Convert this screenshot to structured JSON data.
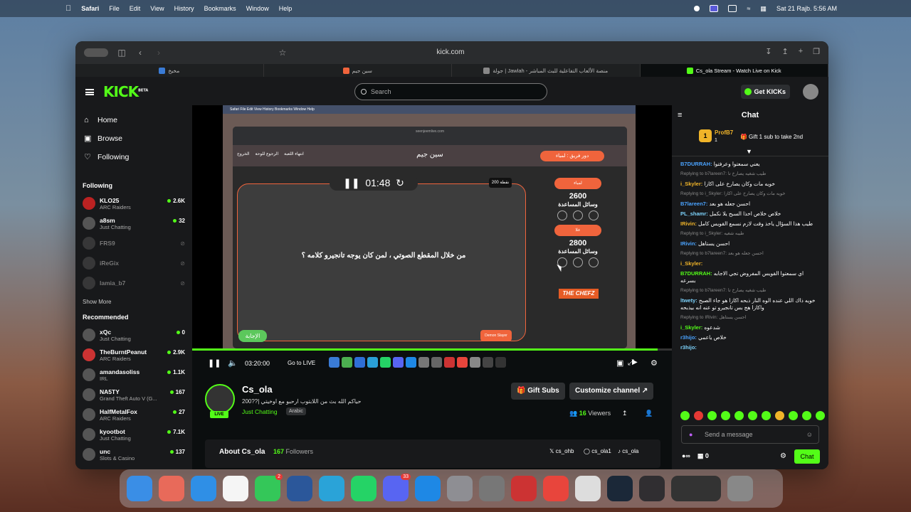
{
  "menubar": {
    "app": "Safari",
    "items": [
      "File",
      "Edit",
      "View",
      "History",
      "Bookmarks",
      "Window",
      "Help"
    ],
    "clock": "Sat 21 Rajb. 5:56 AM"
  },
  "browser": {
    "url": "kick.com",
    "tabs": [
      {
        "label": "مخيخ"
      },
      {
        "label": "سين جيم"
      },
      {
        "label": "جولة | Jawlah - منصة الألعاب التفاعلية للبث المباشر"
      },
      {
        "label": "Cs_ola Stream - Watch Live on Kick"
      }
    ]
  },
  "header": {
    "logo": "KICK",
    "logo_sup": "BETA",
    "search_placeholder": "Search",
    "get_kicks": "Get KICKs"
  },
  "sidebar": {
    "nav": [
      {
        "label": "Home",
        "icon": "home-icon"
      },
      {
        "label": "Browse",
        "icon": "browse-icon"
      },
      {
        "label": "Following",
        "icon": "heart-icon"
      }
    ],
    "following_title": "Following",
    "following": [
      {
        "name": "KLO25",
        "cat": "ARC Raiders",
        "viewers": "2.6K",
        "online": true
      },
      {
        "name": "a8sm",
        "cat": "Just Chatting",
        "viewers": "32",
        "online": true
      },
      {
        "name": "FRS9",
        "cat": "",
        "viewers": "",
        "online": false
      },
      {
        "name": "iReGix",
        "cat": "",
        "viewers": "",
        "online": false
      },
      {
        "name": "lamia_b7",
        "cat": "",
        "viewers": "",
        "online": false
      }
    ],
    "show_more": "Show More",
    "recommended_title": "Recommended",
    "recommended": [
      {
        "name": "xQc",
        "cat": "Just Chatting",
        "viewers": "0"
      },
      {
        "name": "TheBurntPeanut",
        "cat": "ARC Raiders",
        "viewers": "2.9K"
      },
      {
        "name": "amandasoliss",
        "cat": "IRL",
        "viewers": "1.1K"
      },
      {
        "name": "NA5TY",
        "cat": "Grand Theft Auto V (G...",
        "viewers": "167"
      },
      {
        "name": "HalfMetalFox",
        "cat": "ARC Raiders",
        "viewers": "27"
      },
      {
        "name": "kyootbot",
        "cat": "Just Chatting",
        "viewers": "7.1K"
      },
      {
        "name": "unc",
        "cat": "Slots & Casino",
        "viewers": "137"
      }
    ]
  },
  "stream_game": {
    "inner_url": "seenjeemlive.com",
    "title": "سين جيم",
    "team_turn": "دور فريق : لمياء",
    "timer": "01:48",
    "points": "200 نقطة",
    "question": "من خلال المقطع الصوتي ، لمن كان يوجه تانجيرو كلامه ؟",
    "answer_button": "الإجابة",
    "team_tag": "Demon Slayer",
    "team1": {
      "name": "لمياء",
      "score": "2600",
      "aids": "وسائل المساعدة"
    },
    "team2": {
      "name": "علا",
      "score": "2800",
      "aids": "وسائل المساعدة"
    },
    "sponsor": "THE CHEFZ",
    "left_buttons": [
      "الخروج",
      "الرجوع للوحة",
      "انتهاء اللعبة"
    ]
  },
  "player": {
    "time": "03:20:00",
    "go_live": "Go to LIVE",
    "progress": 0.97
  },
  "stream_info": {
    "name": "Cs_ola",
    "live": "LIVE",
    "title": "حياكم الله بث من اللابتوب ارحبو مع اوخيتي |??200",
    "category": "Just Chatting",
    "language": "Arabic",
    "gift_subs": "Gift Subs",
    "customize": "Customize channel",
    "viewers_count": "16",
    "viewers_label": "Viewers",
    "about_title": "About Cs_ola",
    "followers_count": "167",
    "followers_label": "Followers",
    "socials": [
      "cs_ohb",
      "cs_ola1",
      "cs_ola"
    ]
  },
  "chat": {
    "title": "Chat",
    "pinned_user": "ProfB7",
    "pinned_badge": "1",
    "pinned_count": "1",
    "pinned_text": "Gift 1 sub to take 2nd",
    "messages": [
      {
        "type": "msg",
        "user": "B7DURRAH:",
        "text": "يعني سمعتوا وعرفتوا"
      },
      {
        "type": "reply",
        "text": "Replying to b7lareen7: طيب شغيه يصارخ تا"
      },
      {
        "type": "msg",
        "user": "i_Skyler:",
        "text": "خويه مات وكان يصارخ على اكازا"
      },
      {
        "type": "reply",
        "text": "Replying to i_Skyler: خويه مات وكان يصارخ على اكازا"
      },
      {
        "type": "msg",
        "user": "B7lareen7:",
        "text": "احسن جعله هو بعد"
      },
      {
        "type": "msg",
        "user": "PL_shamr:",
        "text": "خلاص خلاص اخذا السبح يلا نكمل"
      },
      {
        "type": "msg",
        "user": "IRivin:",
        "text": "طيب هذا السؤال ياخذ وقت لازم نسمع القويس كامل"
      },
      {
        "type": "reply",
        "text": "Replying to i_Skyler: طيبه شغيه"
      },
      {
        "type": "msg",
        "user": "IRivin:",
        "text": "احسن يستاهل"
      },
      {
        "type": "reply",
        "text": "Replying to b7lareen7: احسن جعله هو بعد"
      },
      {
        "type": "msg",
        "user": "i_Skyler:",
        "text": ""
      },
      {
        "type": "msg",
        "user": "B7DURRAH:",
        "text": "اي سمعتوا القويس المفروض تجي الاجابه بسرعه"
      },
      {
        "type": "reply",
        "text": "Replying to b7lareen7: طيب شغيه يصارخ تا"
      },
      {
        "type": "msg",
        "user": "ltwety:",
        "text": "خويه ذاك اللي عنده الوه النار ذبحه اكازا هو جاء الصبح واكازا هج بس تانجيرو تو عنه انه بيذبحه"
      },
      {
        "type": "reply",
        "text": "Replying to IRivin: احسن يستاهل"
      },
      {
        "type": "msg",
        "user": "i_Skyler:",
        "text": "شدعوه"
      },
      {
        "type": "msg",
        "user": "r3hijo:",
        "text": "خلاص ياعمي"
      },
      {
        "type": "msg",
        "user": "r3hijo:",
        "text": ""
      }
    ],
    "input_placeholder": "Send a message",
    "chat_button": "Chat",
    "footer_count": "0"
  },
  "dock_badges": {
    "messages": "2",
    "discord": "33"
  },
  "colors": {
    "accent": "#53fc18",
    "game_orange": "#f0643c",
    "background": "#0b0e0f",
    "panel": "#18191b"
  }
}
